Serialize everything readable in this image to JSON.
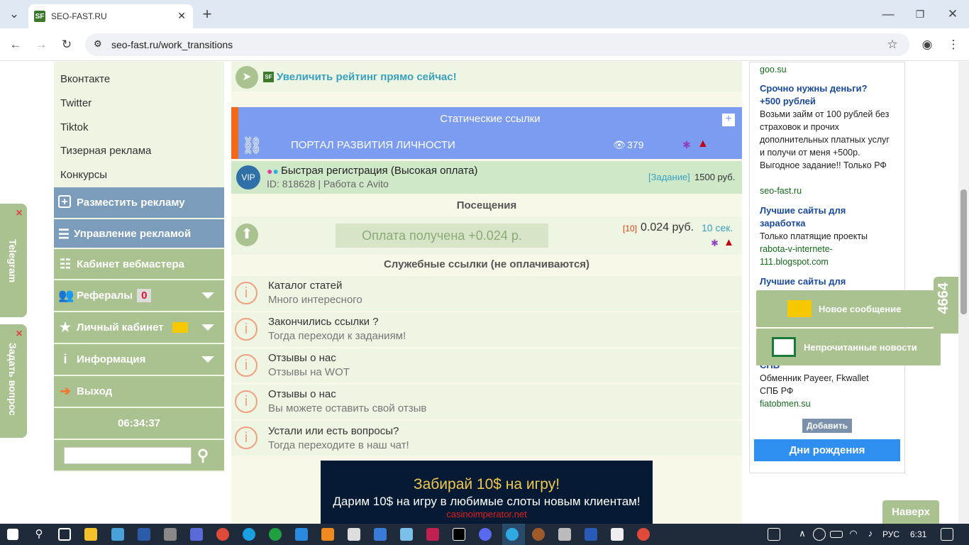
{
  "browser": {
    "tab_title": "SEO-FAST.RU",
    "favicon": "SF",
    "url": "seo-fast.ru/work_transitions"
  },
  "left_menu": {
    "links": [
      "Вконтакте",
      "Twitter",
      "Tiktok",
      "Тизерная реклама",
      "Конкурсы"
    ],
    "place_ad": "Разместить рекламу",
    "manage_ads": "Управление рекламой",
    "webmaster": "Кабинет вебмастера",
    "referrals": "Рефералы",
    "referrals_count": "0",
    "cabinet": "Личный кабинет",
    "info": "Информация",
    "logout": "Выход",
    "clock": "06:34:37"
  },
  "side_tabs": {
    "telegram": "Telegram",
    "ask": "Задать вопрос"
  },
  "center": {
    "rating_text": "Увеличить рейтинг прямо сейчас!",
    "static_links_header": "Статические ссылки",
    "portal": {
      "title": "ПОРТАЛ РАЗВИТИЯ ЛИЧНОСТИ",
      "views": "379"
    },
    "vip": {
      "badge": "VIP",
      "title": "Быстрая регистрация (Высокая оплата)",
      "meta": "ID: 818628 | Работа с Avito",
      "task_label": "[Задание]",
      "price": "1500 руб."
    },
    "visits_header": "Посещения",
    "visit": {
      "status": "Оплата получена +0.024 р.",
      "count": "[10]",
      "price": "0.024 руб.",
      "time": "10 сек."
    },
    "service_header": "Служебные ссылки (не оплачиваются)",
    "service_links": [
      {
        "title": "Каталог статей",
        "subtitle": "Много интересного"
      },
      {
        "title": "Закончились ссылки ?",
        "subtitle": "Тогда переходи к заданиям!"
      },
      {
        "title": "Отзывы о нас",
        "subtitle": "Отзывы на WOT"
      },
      {
        "title": "Отзывы о нас",
        "subtitle": "Вы можете оставить свой отзыв"
      },
      {
        "title": "Устали или есть вопросы?",
        "subtitle": "Тогда переходите в наш чат!"
      }
    ],
    "banner": {
      "headline": "Забирай 10$ на игру!",
      "subline": "Дарим 10$ на игру в любимые слоты новым клиентам!",
      "site": "casinoimperator.net"
    }
  },
  "right_ads": {
    "top_link": "goo.su",
    "ad1_title": "Срочно нужны деньги? +500 рублей",
    "ad1_text": "Возьми займ от 100 рублей без страховок и прочих дополнительных платных услуг и получи от меня +500р. Выгодное задание!! Только РФ",
    "ad1_link": "seo-fast.ru",
    "ad2_title": "Лучшие сайты для заработка",
    "ad2_text": "Только платящие проекты",
    "ad2_link": "rabota-v-internete-111.blogspot.com",
    "ad3_title": "Лучшие сайты для",
    "ad4_title_tail": "СПБ",
    "ad4_text": "Обменник Payeer, Fkwallet СПБ РФ",
    "ad4_link": "fiatobmen.su",
    "add_button": "Добавить",
    "birthdays_button": "Дни рождения"
  },
  "notifications": {
    "new_message": "Новое сообщение",
    "unread_news": "Непрочитанные новости",
    "counter": "4664"
  },
  "back_to_top": "Наверх",
  "taskbar": {
    "lang": "РУС",
    "time": "6:31"
  }
}
